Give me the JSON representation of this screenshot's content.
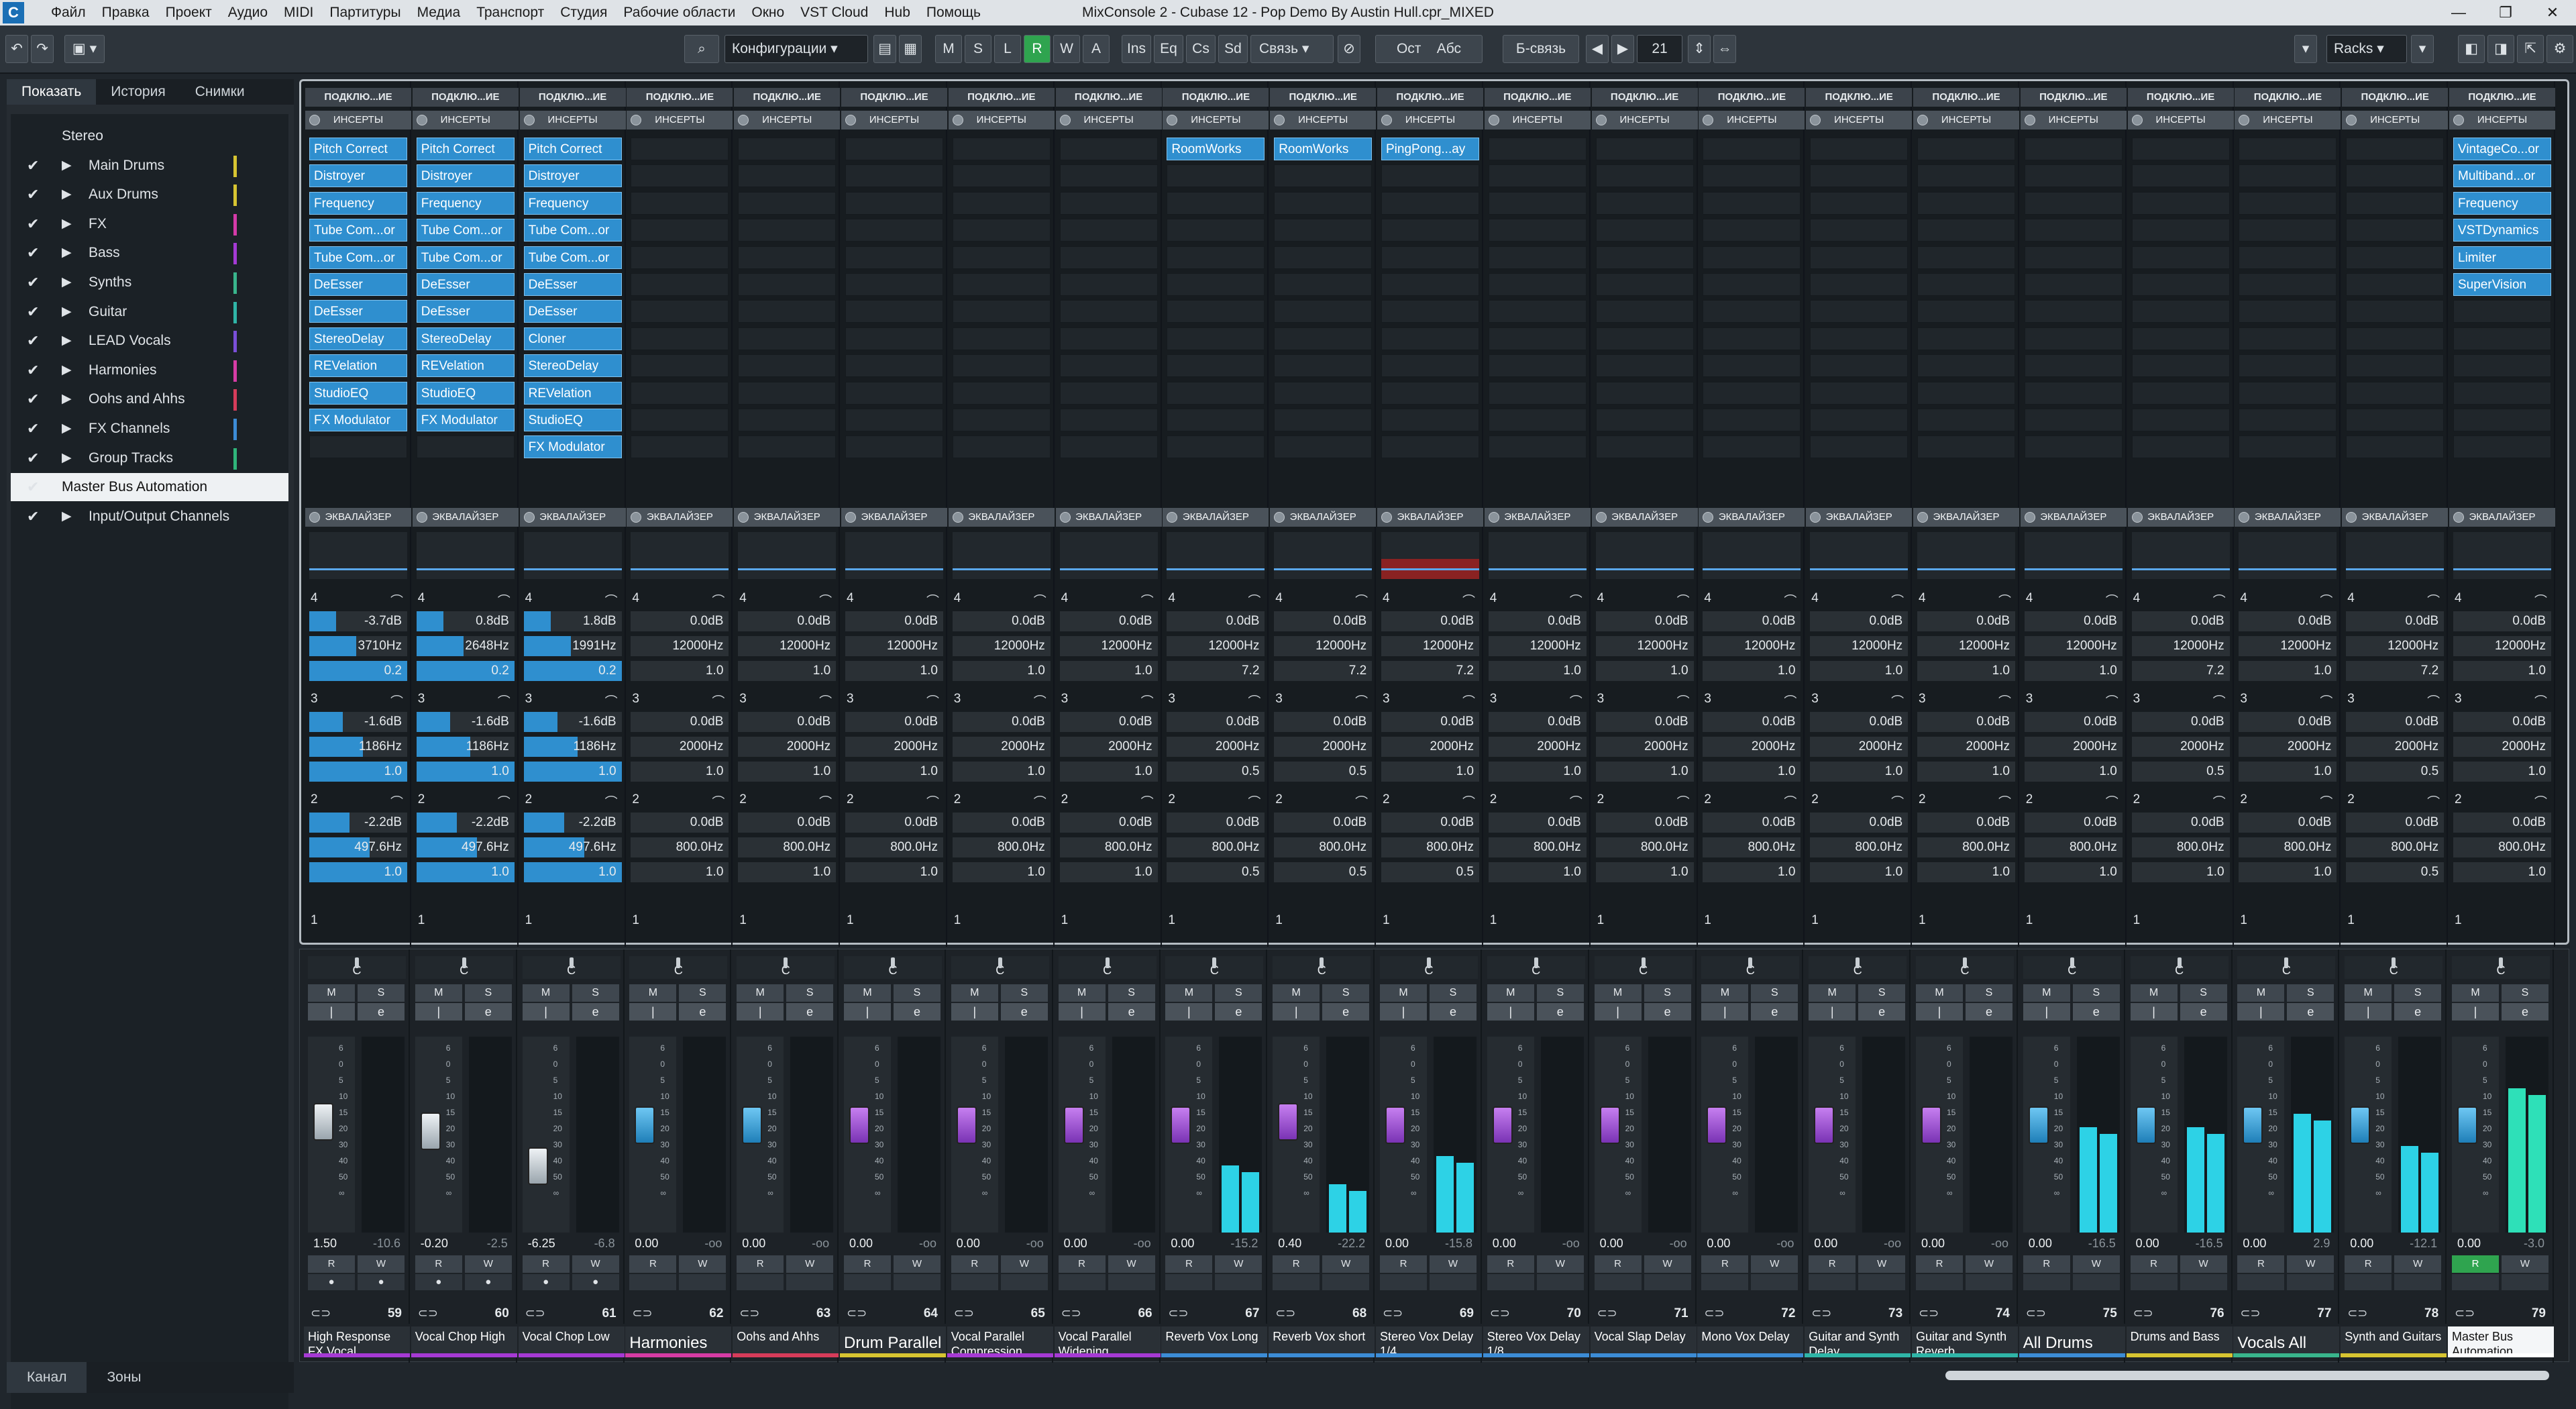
{
  "app": {
    "title": "MixConsole 2 - Cubase 12 - Pop Demo By Austin Hull.cpr_MIXED",
    "menu": [
      "Файл",
      "Правка",
      "Проект",
      "Аудио",
      "MIDI",
      "Партитуры",
      "Медиа",
      "Транспорт",
      "Студия",
      "Рабочие области",
      "Окно",
      "VST Cloud",
      "Hub",
      "Помощь"
    ]
  },
  "toolbar": {
    "config_label": "Конфигурации",
    "M": "M",
    "S": "S",
    "L": "L",
    "R": "R",
    "W": "W",
    "A": "A",
    "ins": "Ins",
    "eq": "Eq",
    "cs": "Cs",
    "sd": "Sd",
    "link_label": "Связь",
    "ost": "Ост",
    "abs": "Абс",
    "blink": "Б-связь",
    "channel_count": "21",
    "racks": "Racks"
  },
  "left_panel": {
    "tabs": [
      "Показать",
      "История",
      "Снимки"
    ],
    "tree": [
      {
        "label": "Stereo",
        "color": "",
        "check": false,
        "arrow": false
      },
      {
        "label": "Main Drums",
        "color": "#d7c431",
        "check": true,
        "arrow": true
      },
      {
        "label": "Aux Drums",
        "color": "#d7c431",
        "check": true,
        "arrow": true
      },
      {
        "label": "FX",
        "color": "#d43aa8",
        "check": true,
        "arrow": true
      },
      {
        "label": "Bass",
        "color": "#a43ad4",
        "check": true,
        "arrow": true
      },
      {
        "label": "Synths",
        "color": "#39b58c",
        "check": true,
        "arrow": true
      },
      {
        "label": "Guitar",
        "color": "#2fb5a7",
        "check": true,
        "arrow": true
      },
      {
        "label": "LEAD Vocals",
        "color": "#7a4fd8",
        "check": true,
        "arrow": true
      },
      {
        "label": "Harmonies",
        "color": "#d63ca5",
        "check": true,
        "arrow": true
      },
      {
        "label": "Oohs and Ahhs",
        "color": "#d63c5a",
        "check": true,
        "arrow": true
      },
      {
        "label": "FX Channels",
        "color": "#3c8cd6",
        "check": true,
        "arrow": true
      },
      {
        "label": "Group Tracks",
        "color": "#2fb57a",
        "check": true,
        "arrow": true
      },
      {
        "label": "Master Bus Automation",
        "color": "",
        "check": true,
        "arrow": false
      },
      {
        "label": "Input/Output Channels",
        "color": "",
        "check": true,
        "arrow": true
      }
    ],
    "bottom_tabs": [
      "Канал",
      "Зоны"
    ]
  },
  "rack": {
    "header": "ПОДКЛЮ...ИЕ",
    "inserts_label": "ИНСЕРТЫ",
    "eq_label": "ЭКВАЛАЙЗЕР"
  },
  "channels": [
    {
      "num": "59",
      "name": "High Response FX Vocal",
      "color": "#a63ad4",
      "fader": "1.50",
      "peak": "-10.6",
      "pan": "C",
      "inserts": [
        "Pitch Correct",
        "Distroyer",
        "Frequency",
        "Tube Com...or",
        "Tube Com...or",
        "DeEsser",
        "DeEsser",
        "StereoDelay",
        "REVelation",
        "StudioEQ",
        "FX Modulator"
      ],
      "eq": [
        [
          "-3.7dB",
          "3710Hz",
          "0.2"
        ],
        [
          "-1.6dB",
          "1186Hz",
          "1.0"
        ],
        [
          "-2.2dB",
          "497.6Hz",
          "1.0"
        ]
      ],
      "knob": "white",
      "meter": 0,
      "fpos": 0.42
    },
    {
      "num": "60",
      "name": "Vocal Chop High",
      "color": "#a63ad4",
      "fader": "-0.20",
      "peak": "-2.5",
      "pan": "C",
      "inserts": [
        "Pitch Correct",
        "Distroyer",
        "Frequency",
        "Tube Com...or",
        "Tube Com...or",
        "DeEsser",
        "DeEsser",
        "StereoDelay",
        "REVelation",
        "StudioEQ",
        "FX Modulator"
      ],
      "eq": [
        [
          "0.8dB",
          "2648Hz",
          "0.2"
        ],
        [
          "-1.6dB",
          "1186Hz",
          "1.0"
        ],
        [
          "-2.2dB",
          "497.6Hz",
          "1.0"
        ]
      ],
      "knob": "white",
      "meter": 0,
      "fpos": 0.48
    },
    {
      "num": "61",
      "name": "Vocal Chop Low",
      "color": "#a63ad4",
      "fader": "-6.25",
      "peak": "-6.8",
      "pan": "C",
      "inserts": [
        "Pitch Correct",
        "Distroyer",
        "Frequency",
        "Tube Com...or",
        "Tube Com...or",
        "DeEsser",
        "DeEsser",
        "Cloner",
        "StereoDelay",
        "REVelation",
        "StudioEQ",
        "FX Modulator"
      ],
      "eq": [
        [
          "1.8dB",
          "1991Hz",
          "0.2"
        ],
        [
          "-1.6dB",
          "1186Hz",
          "1.0"
        ],
        [
          "-2.2dB",
          "497.6Hz",
          "1.0"
        ]
      ],
      "knob": "white",
      "meter": 0,
      "fpos": 0.7
    },
    {
      "num": "62",
      "name": "Harmonies",
      "color": "#d63ca5",
      "fader": "0.00",
      "peak": "-oo",
      "pan": "C",
      "inserts": [],
      "eq": [
        [
          "0.0dB",
          "12000Hz",
          "1.0"
        ],
        [
          "0.0dB",
          "2000Hz",
          "1.0"
        ],
        [
          "0.0dB",
          "800.0Hz",
          "1.0"
        ]
      ],
      "knob": "blue",
      "meter": 0,
      "fpos": 0.44,
      "big": true
    },
    {
      "num": "63",
      "name": "Oohs and Ahhs",
      "color": "#d63c5a",
      "fader": "0.00",
      "peak": "-oo",
      "pan": "C",
      "inserts": [],
      "eq": [
        [
          "0.0dB",
          "12000Hz",
          "1.0"
        ],
        [
          "0.0dB",
          "2000Hz",
          "1.0"
        ],
        [
          "0.0dB",
          "800.0Hz",
          "1.0"
        ]
      ],
      "knob": "blue",
      "meter": 0,
      "fpos": 0.44
    },
    {
      "num": "64",
      "name": "Drum Parallel",
      "color": "#d7c431",
      "fader": "0.00",
      "peak": "-oo",
      "pan": "C",
      "inserts": [],
      "eq": [
        [
          "0.0dB",
          "12000Hz",
          "1.0"
        ],
        [
          "0.0dB",
          "2000Hz",
          "1.0"
        ],
        [
          "0.0dB",
          "800.0Hz",
          "1.0"
        ]
      ],
      "knob": "purple",
      "meter": 0,
      "fpos": 0.44,
      "big": true
    },
    {
      "num": "65",
      "name": "Vocal Parallel Compression",
      "color": "#a63ad4",
      "fader": "0.00",
      "peak": "-oo",
      "pan": "C",
      "inserts": [],
      "eq": [
        [
          "0.0dB",
          "12000Hz",
          "1.0"
        ],
        [
          "0.0dB",
          "2000Hz",
          "1.0"
        ],
        [
          "0.0dB",
          "800.0Hz",
          "1.0"
        ]
      ],
      "knob": "purple",
      "meter": 0,
      "fpos": 0.44
    },
    {
      "num": "66",
      "name": "Vocal Parallel Widening",
      "color": "#a63ad4",
      "fader": "0.00",
      "peak": "-oo",
      "pan": "C",
      "inserts": [],
      "eq": [
        [
          "0.0dB",
          "12000Hz",
          "1.0"
        ],
        [
          "0.0dB",
          "2000Hz",
          "1.0"
        ],
        [
          "0.0dB",
          "800.0Hz",
          "1.0"
        ]
      ],
      "knob": "purple",
      "meter": 0,
      "fpos": 0.44
    },
    {
      "num": "67",
      "name": "Reverb Vox Long",
      "color": "#3c8cd6",
      "fader": "0.00",
      "peak": "-15.2",
      "pan": "C",
      "inserts": [
        "RoomWorks"
      ],
      "eq": [
        [
          "0.0dB",
          "12000Hz",
          "7.2"
        ],
        [
          "0.0dB",
          "2000Hz",
          "0.5"
        ],
        [
          "0.0dB",
          "800.0Hz",
          "0.5"
        ]
      ],
      "knob": "purple",
      "meter": 0.35,
      "fpos": 0.44
    },
    {
      "num": "68",
      "name": "Reverb Vox short",
      "color": "#3c8cd6",
      "fader": "0.40",
      "peak": "-22.2",
      "pan": "C",
      "inserts": [
        "RoomWorks"
      ],
      "eq": [
        [
          "0.0dB",
          "12000Hz",
          "7.2"
        ],
        [
          "0.0dB",
          "2000Hz",
          "0.5"
        ],
        [
          "0.0dB",
          "800.0Hz",
          "0.5"
        ]
      ],
      "knob": "purple",
      "meter": 0.25,
      "fpos": 0.42
    },
    {
      "num": "69",
      "name": "Stereo Vox Delay 1/4",
      "color": "#3c8cd6",
      "fader": "0.00",
      "peak": "-15.8",
      "pan": "C",
      "inserts": [
        "PingPong...ay"
      ],
      "eq": [
        [
          "0.0dB",
          "12000Hz",
          "7.2"
        ],
        [
          "0.0dB",
          "2000Hz",
          "1.0"
        ],
        [
          "0.0dB",
          "800.0Hz",
          "0.5"
        ]
      ],
      "knob": "purple",
      "meter": 0.4,
      "fpos": 0.44,
      "eqred": true
    },
    {
      "num": "70",
      "name": "Stereo Vox Delay 1/8",
      "color": "#3c8cd6",
      "fader": "0.00",
      "peak": "-oo",
      "pan": "C",
      "inserts": [],
      "eq": [
        [
          "0.0dB",
          "12000Hz",
          "1.0"
        ],
        [
          "0.0dB",
          "2000Hz",
          "1.0"
        ],
        [
          "0.0dB",
          "800.0Hz",
          "1.0"
        ]
      ],
      "knob": "purple",
      "meter": 0,
      "fpos": 0.44
    },
    {
      "num": "71",
      "name": "Vocal Slap Delay",
      "color": "#3c8cd6",
      "fader": "0.00",
      "peak": "-oo",
      "pan": "C",
      "inserts": [],
      "eq": [
        [
          "0.0dB",
          "12000Hz",
          "1.0"
        ],
        [
          "0.0dB",
          "2000Hz",
          "1.0"
        ],
        [
          "0.0dB",
          "800.0Hz",
          "1.0"
        ]
      ],
      "knob": "purple",
      "meter": 0,
      "fpos": 0.44
    },
    {
      "num": "72",
      "name": "Mono Vox Delay",
      "color": "#3c8cd6",
      "fader": "0.00",
      "peak": "-oo",
      "pan": "C",
      "inserts": [],
      "eq": [
        [
          "0.0dB",
          "12000Hz",
          "1.0"
        ],
        [
          "0.0dB",
          "2000Hz",
          "1.0"
        ],
        [
          "0.0dB",
          "800.0Hz",
          "1.0"
        ]
      ],
      "knob": "purple",
      "meter": 0,
      "fpos": 0.44
    },
    {
      "num": "73",
      "name": "Guitar and Synth Delay",
      "color": "#2fb5a7",
      "fader": "0.00",
      "peak": "-oo",
      "pan": "C",
      "inserts": [],
      "eq": [
        [
          "0.0dB",
          "12000Hz",
          "1.0"
        ],
        [
          "0.0dB",
          "2000Hz",
          "1.0"
        ],
        [
          "0.0dB",
          "800.0Hz",
          "1.0"
        ]
      ],
      "knob": "purple",
      "meter": 0,
      "fpos": 0.44
    },
    {
      "num": "74",
      "name": "Guitar and Synth Reverb",
      "color": "#2fb5a7",
      "fader": "0.00",
      "peak": "-oo",
      "pan": "C",
      "inserts": [],
      "eq": [
        [
          "0.0dB",
          "12000Hz",
          "1.0"
        ],
        [
          "0.0dB",
          "2000Hz",
          "1.0"
        ],
        [
          "0.0dB",
          "800.0Hz",
          "1.0"
        ]
      ],
      "knob": "purple",
      "meter": 0,
      "fpos": 0.44
    },
    {
      "num": "75",
      "name": "All Drums",
      "color": "#3c8cd6",
      "fader": "0.00",
      "peak": "-16.5",
      "pan": "C",
      "inserts": [],
      "eq": [
        [
          "0.0dB",
          "12000Hz",
          "1.0"
        ],
        [
          "0.0dB",
          "2000Hz",
          "1.0"
        ],
        [
          "0.0dB",
          "800.0Hz",
          "1.0"
        ]
      ],
      "knob": "blue",
      "meter": 0.55,
      "fpos": 0.44,
      "big": true
    },
    {
      "num": "76",
      "name": "Drums and Bass",
      "color": "#d7c431",
      "fader": "0.00",
      "peak": "-16.5",
      "pan": "C",
      "inserts": [],
      "eq": [
        [
          "0.0dB",
          "12000Hz",
          "7.2"
        ],
        [
          "0.0dB",
          "2000Hz",
          "0.5"
        ],
        [
          "0.0dB",
          "800.0Hz",
          "1.0"
        ]
      ],
      "knob": "blue",
      "meter": 0.55,
      "fpos": 0.44
    },
    {
      "num": "77",
      "name": "Vocals All",
      "color": "#39b58c",
      "fader": "0.00",
      "peak": "2.9",
      "pan": "C",
      "inserts": [],
      "eq": [
        [
          "0.0dB",
          "12000Hz",
          "1.0"
        ],
        [
          "0.0dB",
          "2000Hz",
          "1.0"
        ],
        [
          "0.0dB",
          "800.0Hz",
          "1.0"
        ]
      ],
      "knob": "blue",
      "meter": 0.62,
      "fpos": 0.44,
      "big": true
    },
    {
      "num": "78",
      "name": "Synth and Guitars",
      "color": "#d7c431",
      "fader": "0.00",
      "peak": "-12.1",
      "pan": "C",
      "inserts": [],
      "eq": [
        [
          "0.0dB",
          "12000Hz",
          "7.2"
        ],
        [
          "0.0dB",
          "2000Hz",
          "0.5"
        ],
        [
          "0.0dB",
          "800.0Hz",
          "0.5"
        ]
      ],
      "knob": "blue",
      "meter": 0.45,
      "fpos": 0.44
    },
    {
      "num": "79",
      "name": "Master Bus Automation",
      "color": "#ffffff",
      "fader": "0.00",
      "peak": "-3.0",
      "pan": "C",
      "inserts": [
        "VintageCo...or",
        "Multiband...or",
        "Frequency",
        "VSTDynamics",
        "Limiter",
        "SuperVision"
      ],
      "eq": [
        [
          "0.0dB",
          "12000Hz",
          "1.0"
        ],
        [
          "0.0dB",
          "2000Hz",
          "1.0"
        ],
        [
          "0.0dB",
          "800.0Hz",
          "1.0"
        ]
      ],
      "knob": "blue",
      "meter": 0.75,
      "fpos": 0.44,
      "master": true
    }
  ]
}
